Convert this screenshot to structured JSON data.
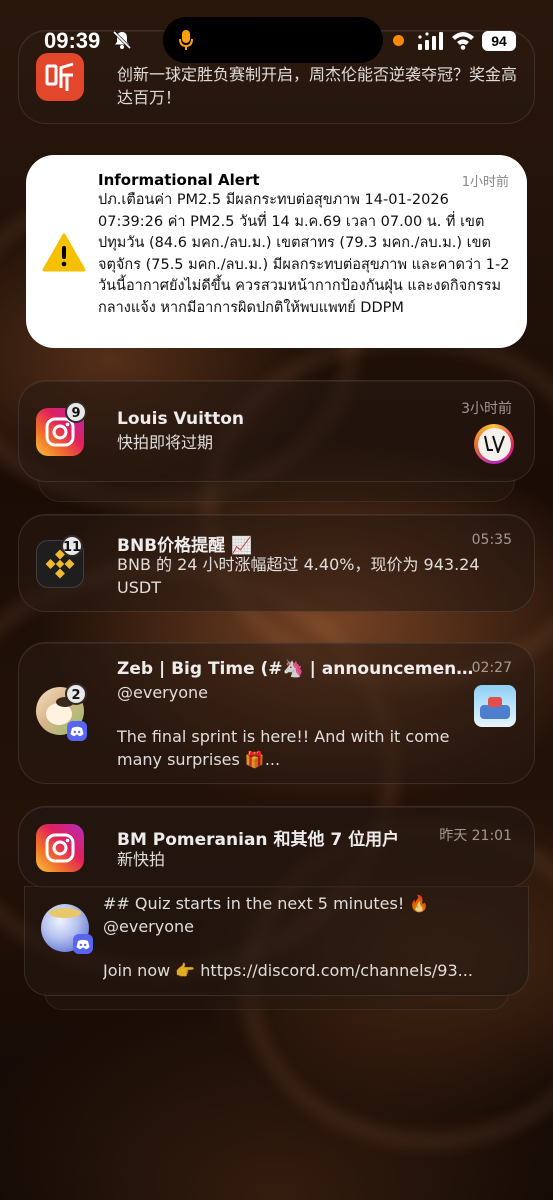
{
  "status_bar": {
    "time": "09:39",
    "battery": "94",
    "icons": [
      "mute-icon",
      "mic-icon",
      "signal-icon",
      "wifi-icon",
      "battery-icon"
    ]
  },
  "notifications": {
    "top_partial": {
      "app_icon": "ting-icon",
      "body": "创新一球定胜负赛制开启，周杰伦能否逆袭夺冠？奖金高达百万！"
    },
    "alert": {
      "app_icon": "warning-icon",
      "title": "Informational Alert",
      "time": "1小时前",
      "body": "ปภ.เตือนค่า PM2.5 มีผลกระทบต่อสุขภาพ  14-01-2026 07:39:26 ค่า PM2.5 วันที่ 14 ม.ค.69 เวลา 07.00 น. ที่ เขตปทุมวัน (84.6 มคก./ลบ.ม.) เขตสาทร (79.3 มคก./ลบ.ม.) เขตจตุจักร (75.5 มคก./ลบ.ม.) มีผลกระทบต่อสุขภาพ และคาดว่า 1-2 วันนี้อากาศยังไม่ดีขึ้น ควรสวมหน้ากากป้องกันฝุ่น และงดกิจกรรมกลางแจ้ง หากมีอาการผิดปกติให้พบแพทย์ DDPM"
    },
    "instagram_lv": {
      "app_icon": "instagram-icon",
      "badge": "9",
      "title": "Louis Vuitton",
      "time": "3小时前",
      "body": "快拍即将过期"
    },
    "binance": {
      "app_icon": "binance-icon",
      "badge": "11",
      "title": "BNB价格提醒 📈",
      "time": "05:35",
      "body": "BNB 的 24 小时涨幅超过 4.40%，现价为 943.24 USDT"
    },
    "discord_zeb": {
      "app_icon": "discord-avatar",
      "badge": "2",
      "title": "Zeb | Big Time (#🦄 | announcement, ...",
      "time": "02:27",
      "line1": "@everyone",
      "line2": "The final sprint is here!! And with it come many surprises 🎁..."
    },
    "instagram_bm": {
      "app_icon": "instagram-icon",
      "title": "BM Pomeranian 和其他 7 位用户",
      "time": "昨天 21:01",
      "body": "新快拍"
    },
    "discord_quiz": {
      "app_icon": "discord-avatar",
      "line1": "## Quiz starts in the next 5 minutes! 🔥",
      "line2": "@everyone",
      "line3": "Join now 👉 https://discord.com/channels/93..."
    }
  }
}
